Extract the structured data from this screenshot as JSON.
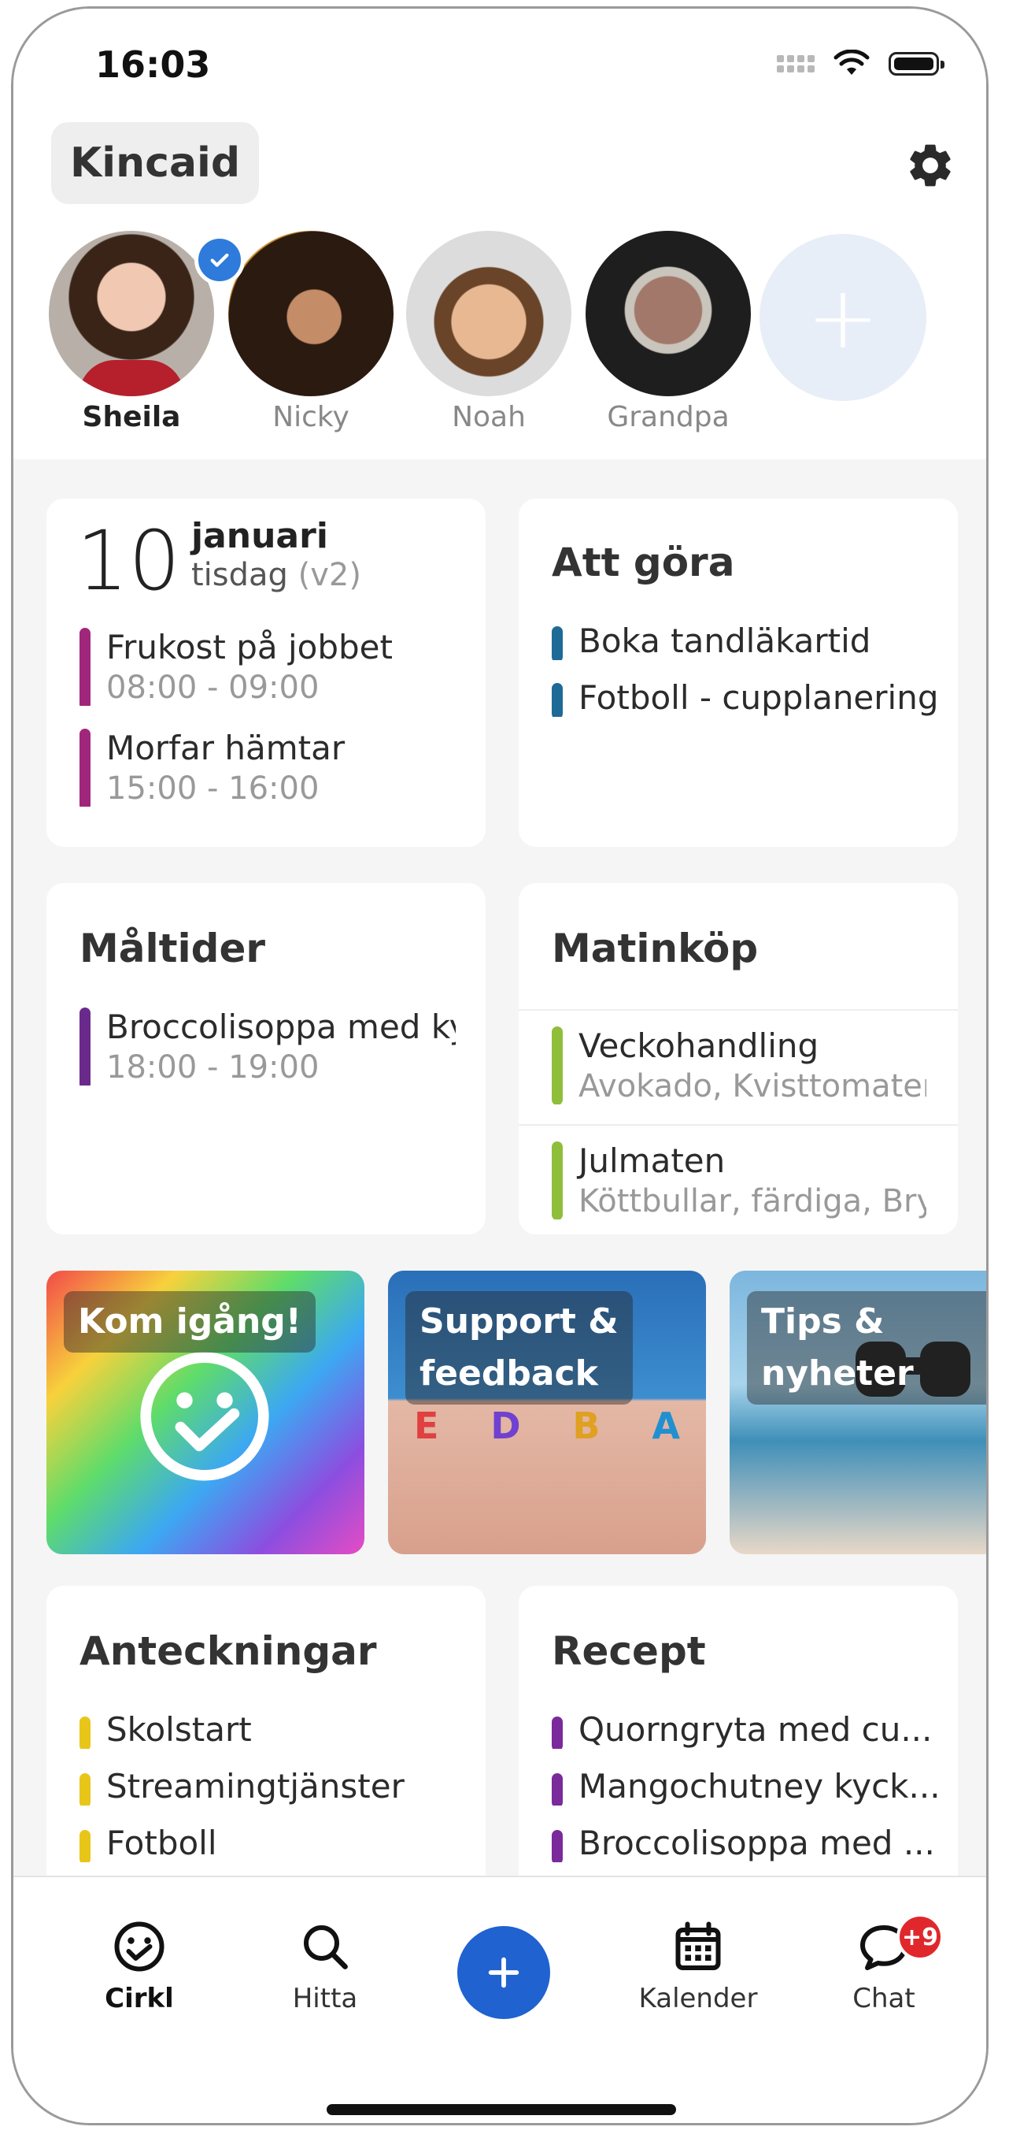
{
  "status_bar": {
    "time": "16:03"
  },
  "household": {
    "name": "Kincaid"
  },
  "members": [
    {
      "name": "Sheila",
      "active": true
    },
    {
      "name": "Nicky",
      "active": false
    },
    {
      "name": "Noah",
      "active": false
    },
    {
      "name": "Grandpa",
      "active": false
    }
  ],
  "calendar_card": {
    "day": "10",
    "month": "januari",
    "weekday": "tisdag",
    "version": "(v2)",
    "events": [
      {
        "title": "Frukost på jobbet",
        "time": "08:00 - 09:00",
        "color": "#a0267c"
      },
      {
        "title": "Morfar hämtar",
        "time": "15:00 - 16:00",
        "color": "#a0267c"
      }
    ]
  },
  "todo_card": {
    "title": "Att göra",
    "items": [
      {
        "label": "Boka tandläkartid",
        "color": "#1e6a96"
      },
      {
        "label": "Fotboll - cupplanering",
        "color": "#1e6a96"
      }
    ]
  },
  "meals_card": {
    "title": "Måltider",
    "items": [
      {
        "label": "Broccolisoppa med kyckling",
        "time": "18:00 - 19:00",
        "color": "#6a2a8c"
      }
    ]
  },
  "shopping_card": {
    "title": "Matinköp",
    "lists": [
      {
        "label": "Veckohandling",
        "detail": "Avokado, Kvisttomater, Gurka",
        "color": "#8fbe3a"
      },
      {
        "label": "Julmaten",
        "detail": "Köttbullar, färdiga, Brysselkål",
        "color": "#8fbe3a"
      }
    ]
  },
  "tiles": [
    {
      "label": "Kom igång!"
    },
    {
      "label_line1": "Support &",
      "label_line2": "feedback",
      "letters": [
        "E",
        "D",
        "B",
        "A"
      ]
    },
    {
      "label_line1": "Tips &",
      "label_line2": "nyheter"
    }
  ],
  "notes_card": {
    "title": "Anteckningar",
    "items": [
      {
        "label": "Skolstart",
        "color": "#e8c619"
      },
      {
        "label": "Streamingtjänster",
        "color": "#e8c619"
      },
      {
        "label": "Fotboll",
        "color": "#e8c619"
      }
    ]
  },
  "recipes_card": {
    "title": "Recept",
    "items": [
      {
        "label": "Quorngryta med cu...",
        "color": "#7a2a9a"
      },
      {
        "label": "Mangochutney kyck...",
        "color": "#7a2a9a"
      },
      {
        "label": "Broccolisoppa med ...",
        "color": "#7a2a9a"
      }
    ]
  },
  "bottom_nav": {
    "items": [
      {
        "label": "Cirkl",
        "icon": "smiley-icon",
        "active": true
      },
      {
        "label": "Hitta",
        "icon": "search-icon",
        "active": false
      },
      {
        "label": "Kalender",
        "icon": "calendar-icon",
        "active": false
      },
      {
        "label": "Chat",
        "icon": "chat-icon",
        "active": false,
        "badge": "+9"
      }
    ],
    "fab_icon": "plus-icon"
  },
  "colors": {
    "accent": "#1f62d0",
    "check": "#2e7bdc",
    "badge": "#e0282c"
  }
}
